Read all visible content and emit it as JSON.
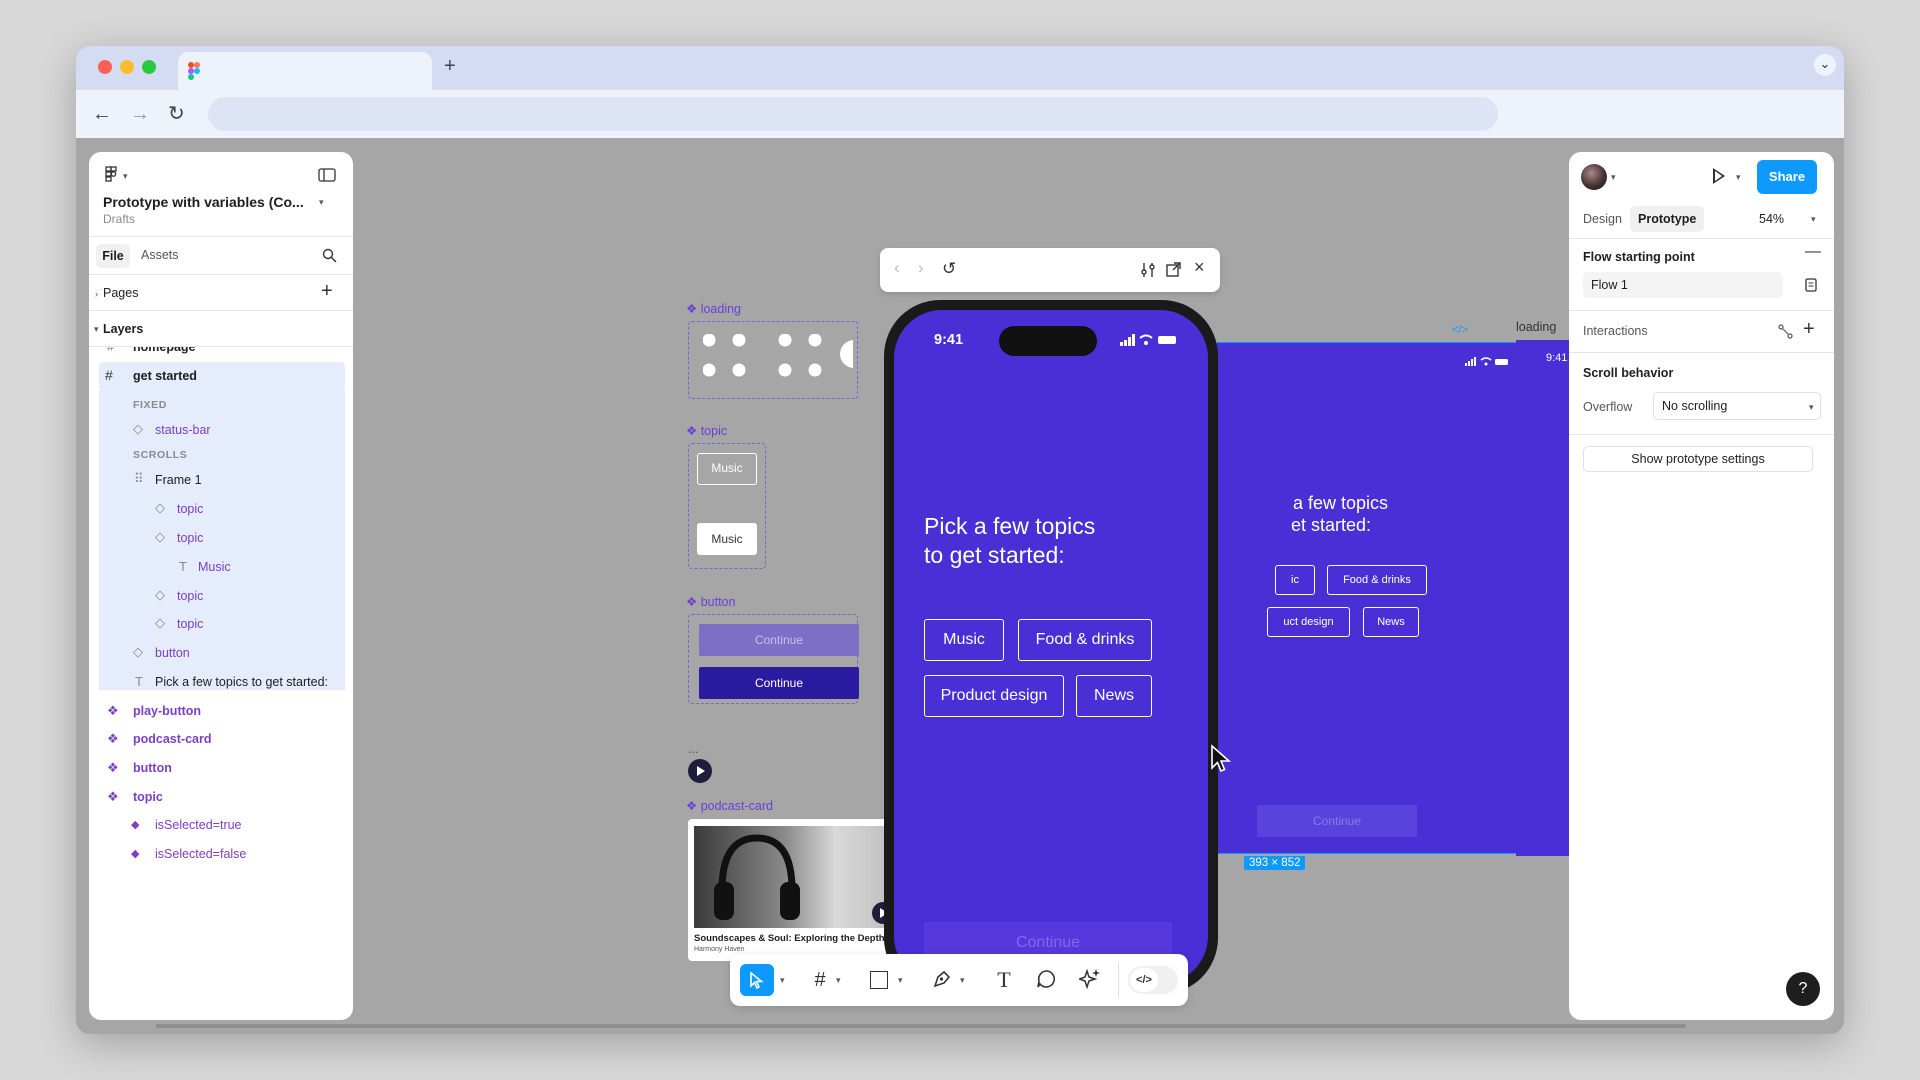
{
  "browser": {
    "tab_icon": "figma-logo",
    "new_tab": "+",
    "back": "←",
    "forward": "→",
    "reload": "↻",
    "menu": "⌄"
  },
  "left_panel": {
    "file_title": "Prototype with variables (Co...",
    "location": "Drafts",
    "tabs": [
      "File",
      "Assets"
    ],
    "pages_label": "Pages",
    "layers_label": "Layers",
    "layers": [
      {
        "label": "homepage",
        "type": "frame"
      },
      {
        "label": "get started",
        "type": "frame"
      },
      {
        "label": "FIXED",
        "type": "section"
      },
      {
        "label": "status-bar",
        "type": "instance"
      },
      {
        "label": "SCROLLS",
        "type": "section"
      },
      {
        "label": "Frame 1",
        "type": "grid"
      },
      {
        "label": "topic",
        "type": "instance"
      },
      {
        "label": "topic",
        "type": "instance"
      },
      {
        "label": "Music",
        "type": "text"
      },
      {
        "label": "topic",
        "type": "instance"
      },
      {
        "label": "topic",
        "type": "instance"
      },
      {
        "label": "button",
        "type": "instance"
      },
      {
        "label": "Pick a few topics to get started:",
        "type": "text"
      },
      {
        "label": "play-button",
        "type": "component"
      },
      {
        "label": "podcast-card",
        "type": "component"
      },
      {
        "label": "button",
        "type": "component"
      },
      {
        "label": "topic",
        "type": "component"
      },
      {
        "label": "isSelected=true",
        "type": "variant"
      },
      {
        "label": "isSelected=false",
        "type": "variant"
      }
    ]
  },
  "canvas": {
    "labels": {
      "loading": "loading",
      "topic": "topic",
      "button": "button",
      "podcast_card": "podcast-card",
      "loading_right": "loading",
      "ellipsis": "..."
    },
    "topic_chips": [
      "Music",
      "Music"
    ],
    "buttons": [
      "Continue",
      "Continue"
    ],
    "podcast": {
      "title": "Soundscapes & Soul: Exploring the Depths of...",
      "author": "Harmony Haven"
    },
    "frame_size": "393 × 852",
    "bg_frame": {
      "heading_line1": "a few topics",
      "heading_line2": "et started:",
      "chips": [
        "ic",
        "Food & drinks",
        "uct design",
        "News"
      ],
      "continue": "Continue"
    },
    "right_frame_time": "9:41",
    "code_tag": "</>"
  },
  "preview": {
    "time": "9:41",
    "heading_line1": "Pick a few topics",
    "heading_line2": "to get started:",
    "topics": [
      "Music",
      "Food & drinks",
      "Product design",
      "News"
    ],
    "continue": "Continue"
  },
  "right_panel": {
    "share": "Share",
    "tabs": [
      "Design",
      "Prototype"
    ],
    "zoom": "54%",
    "flow_section": "Flow starting point",
    "flow_name": "Flow 1",
    "interactions": "Interactions",
    "scroll_behavior": "Scroll behavior",
    "overflow_label": "Overflow",
    "overflow_value": "No scrolling",
    "show_settings": "Show prototype settings",
    "help": "?"
  },
  "toolbar": {
    "tools": [
      "move-tool",
      "frame-tool",
      "shape-tool",
      "pen-tool",
      "text-tool",
      "comment-tool",
      "actions-tool",
      "dev-mode-toggle"
    ]
  },
  "colors": {
    "accent": "#0d99ff",
    "frame_purple": "#4a2fd6",
    "component_purple": "#7b3fc7",
    "canvas_bg": "#a6a6a6"
  }
}
